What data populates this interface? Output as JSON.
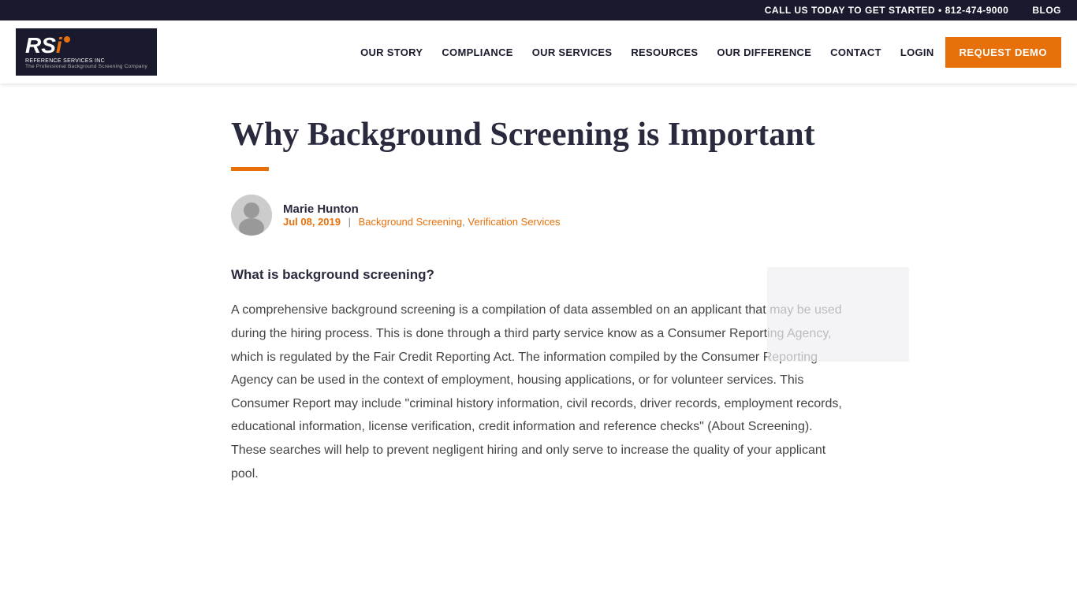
{
  "topbar": {
    "cta_text": "CALL US TODAY TO GET STARTED • 812-474-9000",
    "blog_label": "BLOG"
  },
  "header": {
    "logo": {
      "letters": "RSi",
      "company_name": "REFERENCE SERVICES INC",
      "tagline": "The Professional Background Screening Company"
    },
    "nav": {
      "items": [
        {
          "label": "OUR STORY",
          "id": "our-story"
        },
        {
          "label": "COMPLIANCE",
          "id": "compliance"
        },
        {
          "label": "OUR SERVICES",
          "id": "our-services"
        },
        {
          "label": "RESOURCES",
          "id": "resources"
        },
        {
          "label": "OUR DIFFERENCE",
          "id": "our-difference"
        },
        {
          "label": "CONTACT",
          "id": "contact"
        },
        {
          "label": "LOGIN",
          "id": "login"
        }
      ],
      "cta_button": "REQUEST DEMO"
    }
  },
  "article": {
    "title": "Why Background Screening is Important",
    "author": {
      "name": "Marie Hunton",
      "date": "Jul 08, 2019",
      "categories": [
        {
          "label": "Background Screening",
          "id": "background-screening"
        },
        {
          "label": "Verification Services",
          "id": "verification-services"
        }
      ],
      "separator": "|"
    },
    "section_heading": "What is background screening?",
    "body_text": "A comprehensive background screening is a compilation of data assembled on an applicant that may be used during the hiring process. This is done through a third party service know as a Consumer Reporting Agency, which is regulated by the Fair Credit Reporting Act.  The information compiled by the Consumer Reporting Agency can be used in the context of employment, housing applications, or for volunteer services. This Consumer Report may include \"criminal history information, civil records, driver records, employment records, educational information, license verification, credit information and reference checks\" (About Screening). These searches will help to prevent negligent hiring and only serve to increase the quality of your applicant pool."
  }
}
